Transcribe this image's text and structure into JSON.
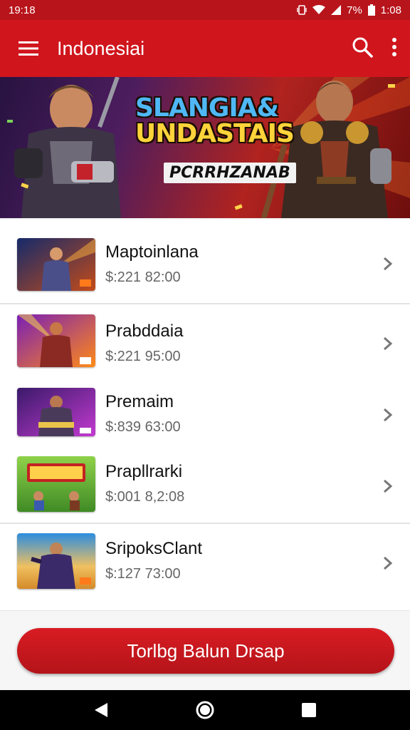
{
  "status_bar": {
    "time": "19:18",
    "battery_percent": "7%",
    "right_time": "1:08"
  },
  "app_bar": {
    "title": "Indonesiai",
    "menu_icon": "hamburger-menu-icon",
    "search_icon": "search-icon",
    "overflow_icon": "more-vert-icon"
  },
  "banner": {
    "title_line1": "SLANGIA&",
    "title_line2": "UNDASTAIS",
    "subtitle": "PCRRHZANAB"
  },
  "items": [
    {
      "name": "Maptoinlana",
      "price": "$:221 82:00"
    },
    {
      "name": "Prabddaia",
      "price": "$:221 95:00"
    },
    {
      "name": "Premaim",
      "price": "$:839 63:00"
    },
    {
      "name": "Prapllrarki",
      "price": "$:001 8,2:08"
    },
    {
      "name": "SripoksClant",
      "price": "$:127 73:00"
    }
  ],
  "cta": {
    "label": "Torlbg Balun Drsap"
  },
  "colors": {
    "primary_red": "#d0151d",
    "status_red": "#b8141b"
  }
}
